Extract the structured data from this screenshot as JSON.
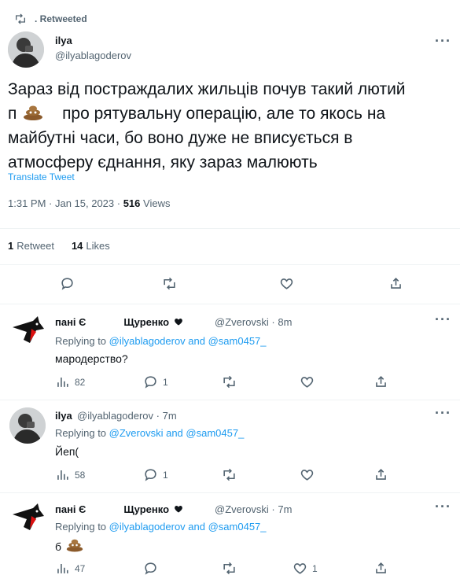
{
  "retweet_header": {
    "icon": "retweet-icon",
    "label": ". Retweeted"
  },
  "main_tweet": {
    "author_name": "ilya",
    "author_handle": "@ilyablagoderov",
    "text_line1": "Зараз від постраждалих жильців почув такий лютий",
    "text_line2_prefix": "п",
    "text_line2_suffix": "про рятувальну операцію, але то якось на",
    "text_line3": "майбутні часи, бо воно дуже не вписується в",
    "text_line4": "атмосферу єднання, яку зараз малюють",
    "translate_label": "Translate Tweet",
    "meta_time": "1:31 PM · Jan 15, 2023 · ",
    "meta_views_count": "516",
    "meta_views_label": " Views",
    "retweets_count": "1",
    "retweets_label": "Retweet",
    "likes_count": "14",
    "likes_label": "Likes"
  },
  "replies": [
    {
      "name_part1": "пані Є",
      "name_part2": "Щуренко",
      "handle_time": "@Zverovski · 8m",
      "replying_prefix": "Replying to ",
      "replying_user1": "@ilyablagoderov",
      "replying_and": " and ",
      "replying_user2": "@sam0457_",
      "text": "мародерство?",
      "views": "82",
      "replies_count": "1",
      "likes_count": ""
    },
    {
      "name": "ilya",
      "handle_time": "@ilyablagoderov · 7m",
      "replying_prefix": "Replying to ",
      "replying_user1": "@Zverovski",
      "replying_and": " and ",
      "replying_user2": "@sam0457_",
      "text": "Йеп(",
      "views": "58",
      "replies_count": "1",
      "likes_count": ""
    },
    {
      "name_part1": "пані Є",
      "name_part2": "Щуренко",
      "handle_time": "@Zverovski · 7m",
      "replying_prefix": "Replying to ",
      "replying_user1": "@ilyablagoderov",
      "replying_and": " and ",
      "replying_user2": "@sam0457_",
      "text": "б",
      "views": "47",
      "replies_count": "",
      "likes_count": "1"
    }
  ],
  "more_label": "···"
}
